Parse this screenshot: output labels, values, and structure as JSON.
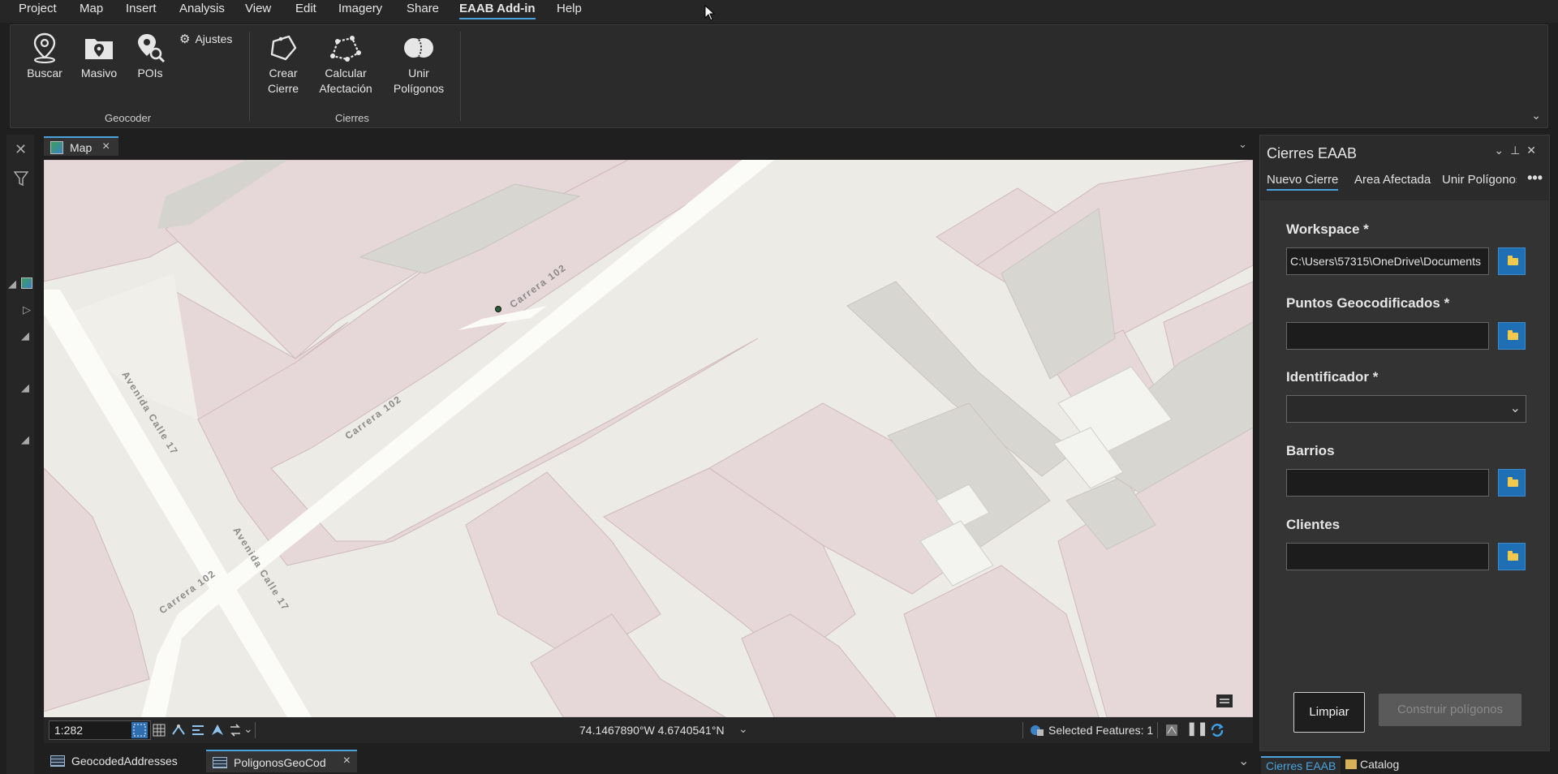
{
  "menu": [
    "Project",
    "Map",
    "Insert",
    "Analysis",
    "View",
    "Edit",
    "Imagery",
    "Share",
    "EAAB Add-in",
    "Help"
  ],
  "menu_active": "EAAB Add-in",
  "ribbon": {
    "geocoder": {
      "label": "Geocoder",
      "buscar": "Buscar",
      "masivo": "Masivo",
      "pois": "POIs",
      "ajustes": "Ajustes"
    },
    "cierres": {
      "label": "Cierres",
      "crear_line1": "Crear",
      "crear_line2": "Cierre",
      "calcular_line1": "Calcular",
      "calcular_line2": "Afectación",
      "unir_line1": "Unir",
      "unir_line2": "Polígonos"
    }
  },
  "map_tab": {
    "label": "Map"
  },
  "map": {
    "labels": [
      "Carrera 102",
      "Carrera 102",
      "Avenida Calle 17",
      "Avenida Calle 17",
      "Carrera 102"
    ],
    "colors": {
      "background": "#ecebe6",
      "parcel": "#e6d7d8",
      "parcel_edge": "#cfb9bd",
      "road": "#fbfbf8"
    }
  },
  "status": {
    "scale": "1:282",
    "coords": "74.1467890°W 4.6740541°N",
    "selected_features": "Selected Features: 1"
  },
  "bottom_tabs": [
    {
      "label": "GeocodedAddresses"
    },
    {
      "label": "PoligonosGeoCod"
    }
  ],
  "panel": {
    "title": "Cierres EAAB",
    "tabs": [
      "Nuevo Cierre",
      "Area Afectada",
      "Unir Polígonos"
    ],
    "fields": {
      "workspace_label": "Workspace *",
      "workspace_value": "C:\\Users\\57315\\OneDrive\\Documents",
      "puntos_label": "Puntos Geocodificados *",
      "puntos_value": "",
      "identificador_label": "Identificador *",
      "barrios_label": "Barrios",
      "barrios_value": "",
      "clientes_label": "Clientes",
      "clientes_value": ""
    },
    "btn_limpiar": "Limpiar",
    "btn_construir": "Construir polígonos",
    "bottom_tabs": [
      "Cierres EAAB",
      "Catalog"
    ]
  }
}
